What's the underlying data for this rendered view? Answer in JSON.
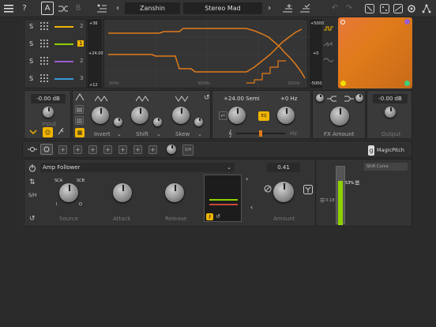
{
  "topbar": {
    "menu_icon": "hamburger-icon",
    "help": "?",
    "mode_a": "A",
    "mode_b": "B",
    "nav_prev": "‹",
    "nav_next": "›",
    "preset_bank": "Zanshin",
    "preset_name": "Stereo Mad"
  },
  "bands": {
    "labels": [
      "S",
      "S",
      "S",
      "S"
    ],
    "numbers": [
      "2",
      "1",
      "2",
      "3"
    ],
    "colors": [
      "#f0b400",
      "#8ed000",
      "#9a5cd0",
      "#3a9ad8"
    ]
  },
  "graph": {
    "axis_top": "+36",
    "axis_mid": "+24.00",
    "axis_bottom": "+12",
    "x_labels": [
      "50Hz",
      "300Hz",
      "20kHz"
    ],
    "accent": "#e07b1a"
  },
  "meter": {
    "top": "+5000",
    "mid": "+0",
    "bottom": "-5000"
  },
  "input": {
    "value": "-0.00 dB",
    "label": "Input"
  },
  "shape_labels": {
    "invert": "Invert",
    "shift": "Shift",
    "skew": "Skew"
  },
  "pitch": {
    "semi": "+24.00 Semi",
    "hz": "+0 Hz",
    "hz_unit": "Hz",
    "mode": "EQ"
  },
  "fx": {
    "label": "FX Amount"
  },
  "output": {
    "value": "-0.00 dB",
    "label": "Output"
  },
  "mod": {
    "sh_label": "S/H",
    "brand": "MagicPitch",
    "source_select": "Amp Follower",
    "amount_value": "0.41",
    "labels": {
      "source": "Source",
      "attack": "Attack",
      "release": "Release",
      "amount": "Amount"
    },
    "sca": "SCA",
    "scb": "SCB",
    "i": "I",
    "o": "O",
    "shift_curve": "Shift Curve",
    "pct": "53%",
    "small_val": "0.18",
    "sh": "S/H"
  }
}
